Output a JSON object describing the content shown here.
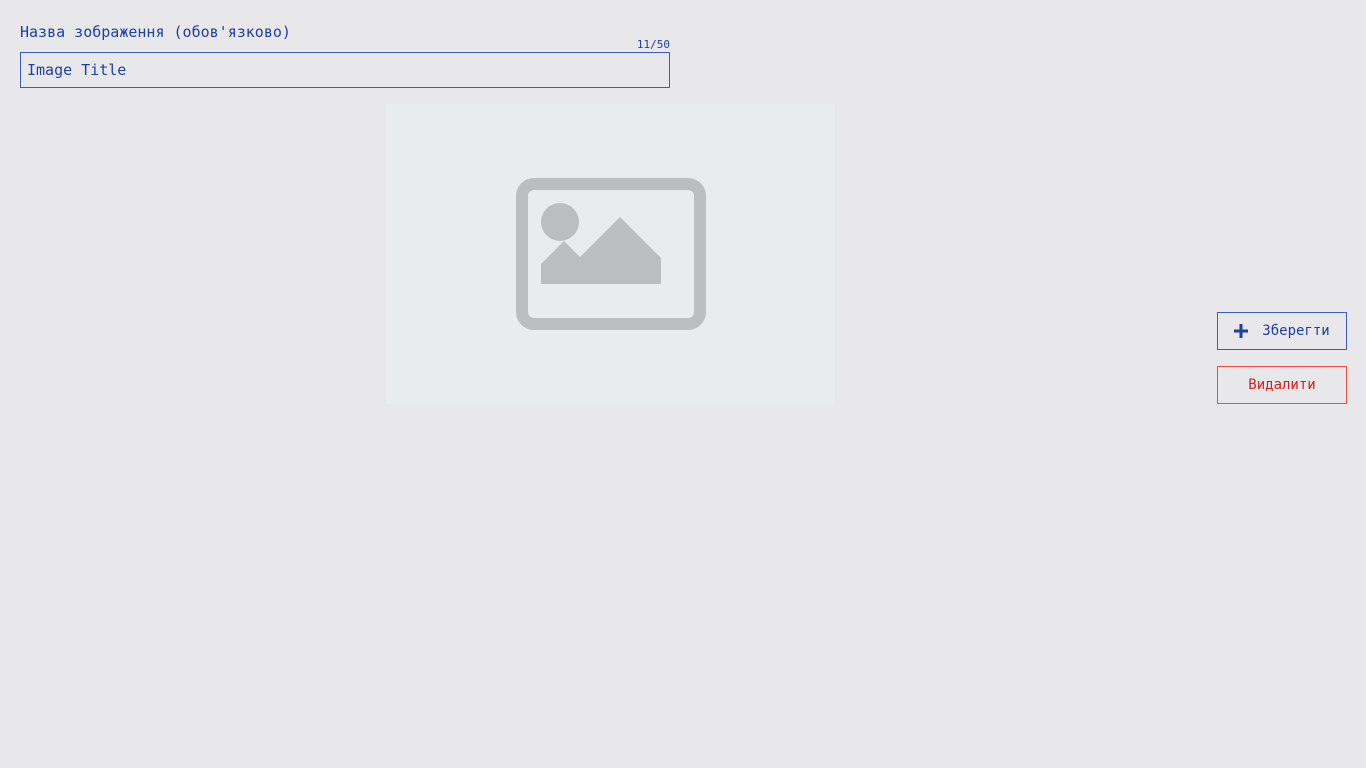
{
  "form": {
    "title_label": "Назва зображення (обов'язково)",
    "char_counter": "11/50",
    "title_value": "Image Title"
  },
  "image": {
    "placeholder_icon": "image-placeholder-icon"
  },
  "actions": {
    "save_label": "Зберегти",
    "save_icon": "plus-icon",
    "delete_label": "Видалити"
  },
  "colors": {
    "background": "#e8e8ea",
    "accent": "#1e3ea8",
    "danger": "#d91d1d",
    "placeholder_bg": "#e9ecef",
    "placeholder_icon": "#bbbec1"
  }
}
